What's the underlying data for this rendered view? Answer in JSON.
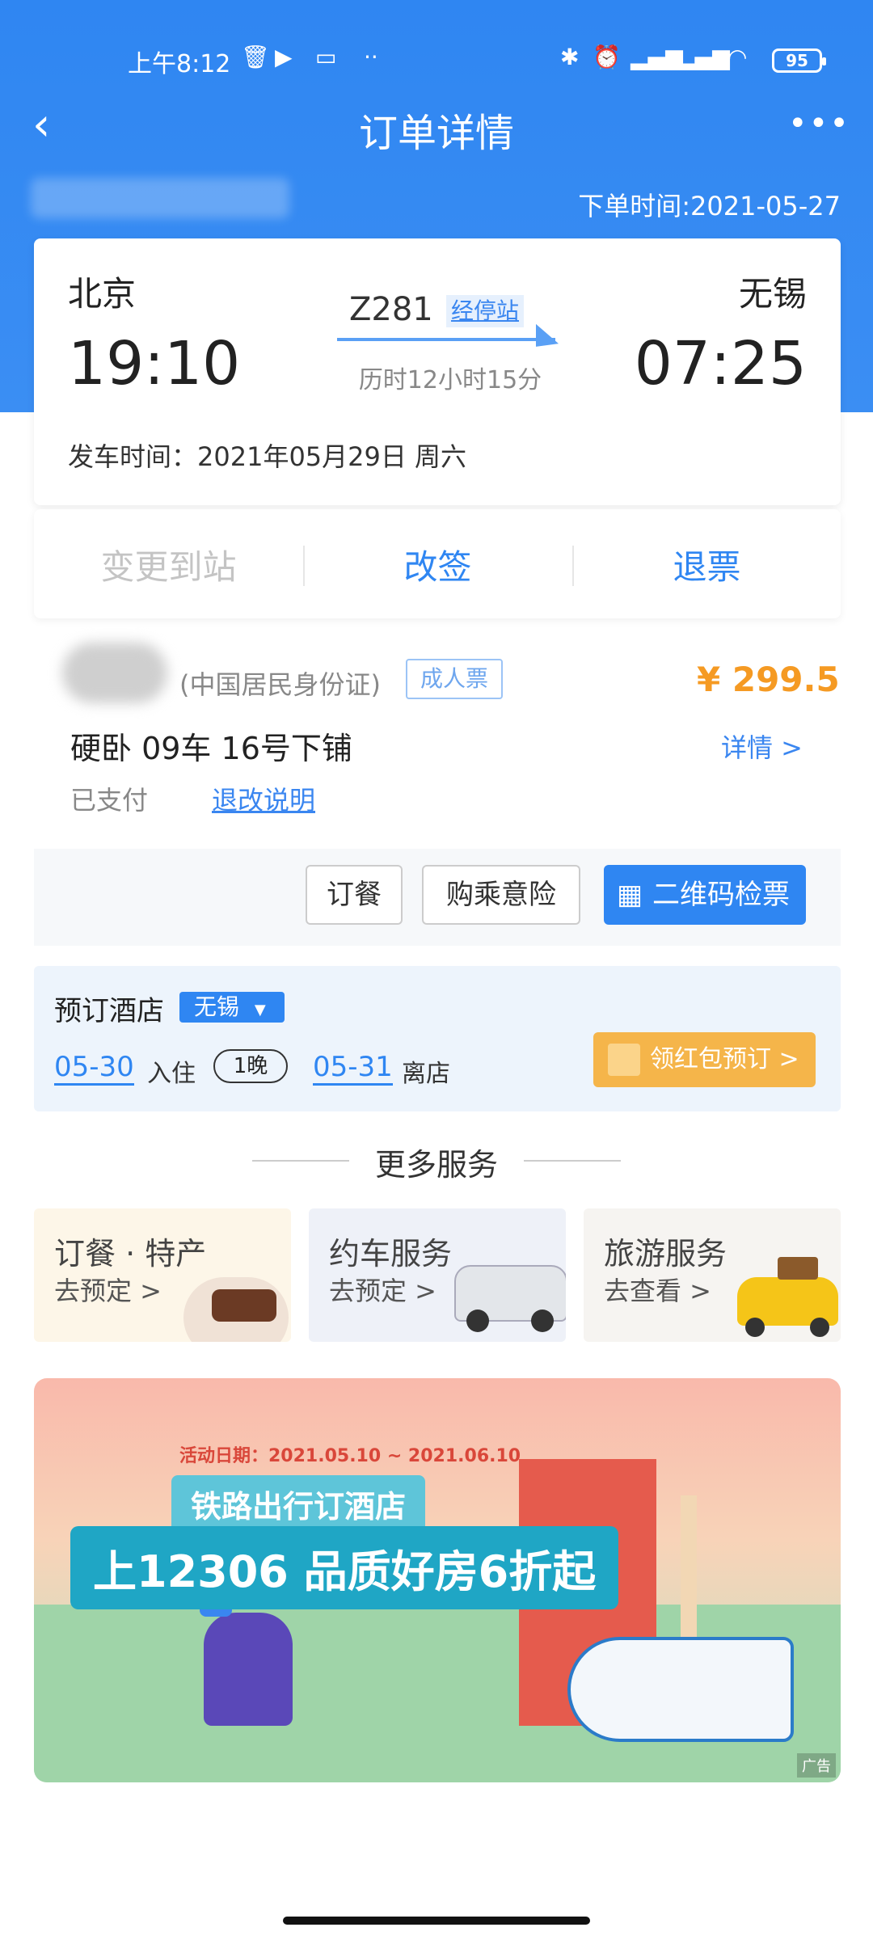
{
  "status_bar": {
    "time": "上午8:12",
    "icons": [
      "trash-icon",
      "play-icon",
      "vr-icon",
      "more-dots-icon",
      "bluetooth-icon",
      "alarm-icon",
      "signal-hd-icon",
      "signal-hd-icon",
      "wifi-icon"
    ],
    "battery": "95"
  },
  "nav": {
    "title": "订单详情",
    "back_icon": "‹",
    "more_icon": "•••"
  },
  "order_time": "下单时间:2021-05-27",
  "train": {
    "from_station": "北京",
    "to_station": "无锡",
    "depart_time": "19:10",
    "arrive_time": "07:25",
    "train_no": "Z281",
    "via_label": "经停站",
    "duration": "历时12小时15分",
    "depart_date": "发车时间：2021年05月29日 周六"
  },
  "actions": {
    "change_station": "变更到站",
    "reschedule": "改签",
    "refund": "退票"
  },
  "passenger": {
    "id_type": "(中国居民身份证)",
    "ticket_type": "成人票",
    "price": "¥ 299.5",
    "seat": "硬卧 09车 16号下铺",
    "detail": "详情 >",
    "status": "已支付",
    "rule_link": "退改说明"
  },
  "buttons": {
    "meal": "订餐",
    "insurance": "购乘意险",
    "qrcode": "二维码检票"
  },
  "hotel": {
    "title": "预订酒店",
    "city": "无锡",
    "checkin_date": "05-30",
    "checkin_label": "入住",
    "nights": "1晚",
    "checkout_date": "05-31",
    "checkout_label": "离店",
    "cta": "领红包预订 >"
  },
  "more_services": {
    "title": "更多服务",
    "items": [
      {
        "title": "订餐 · 特产",
        "sub": "去预定 >"
      },
      {
        "title": "约车服务",
        "sub": "去预定 >"
      },
      {
        "title": "旅游服务",
        "sub": "去查看 >"
      }
    ]
  },
  "banner": {
    "date": "活动日期：2021.05.10 ~ 2021.06.10",
    "line1": "铁路出行订酒店",
    "line2": "上12306 品质好房6折起",
    "ad_tag": "广告"
  },
  "colors": {
    "primary": "#2f86f2",
    "price": "#f59a23",
    "hotel_bg": "#edf4fc"
  }
}
